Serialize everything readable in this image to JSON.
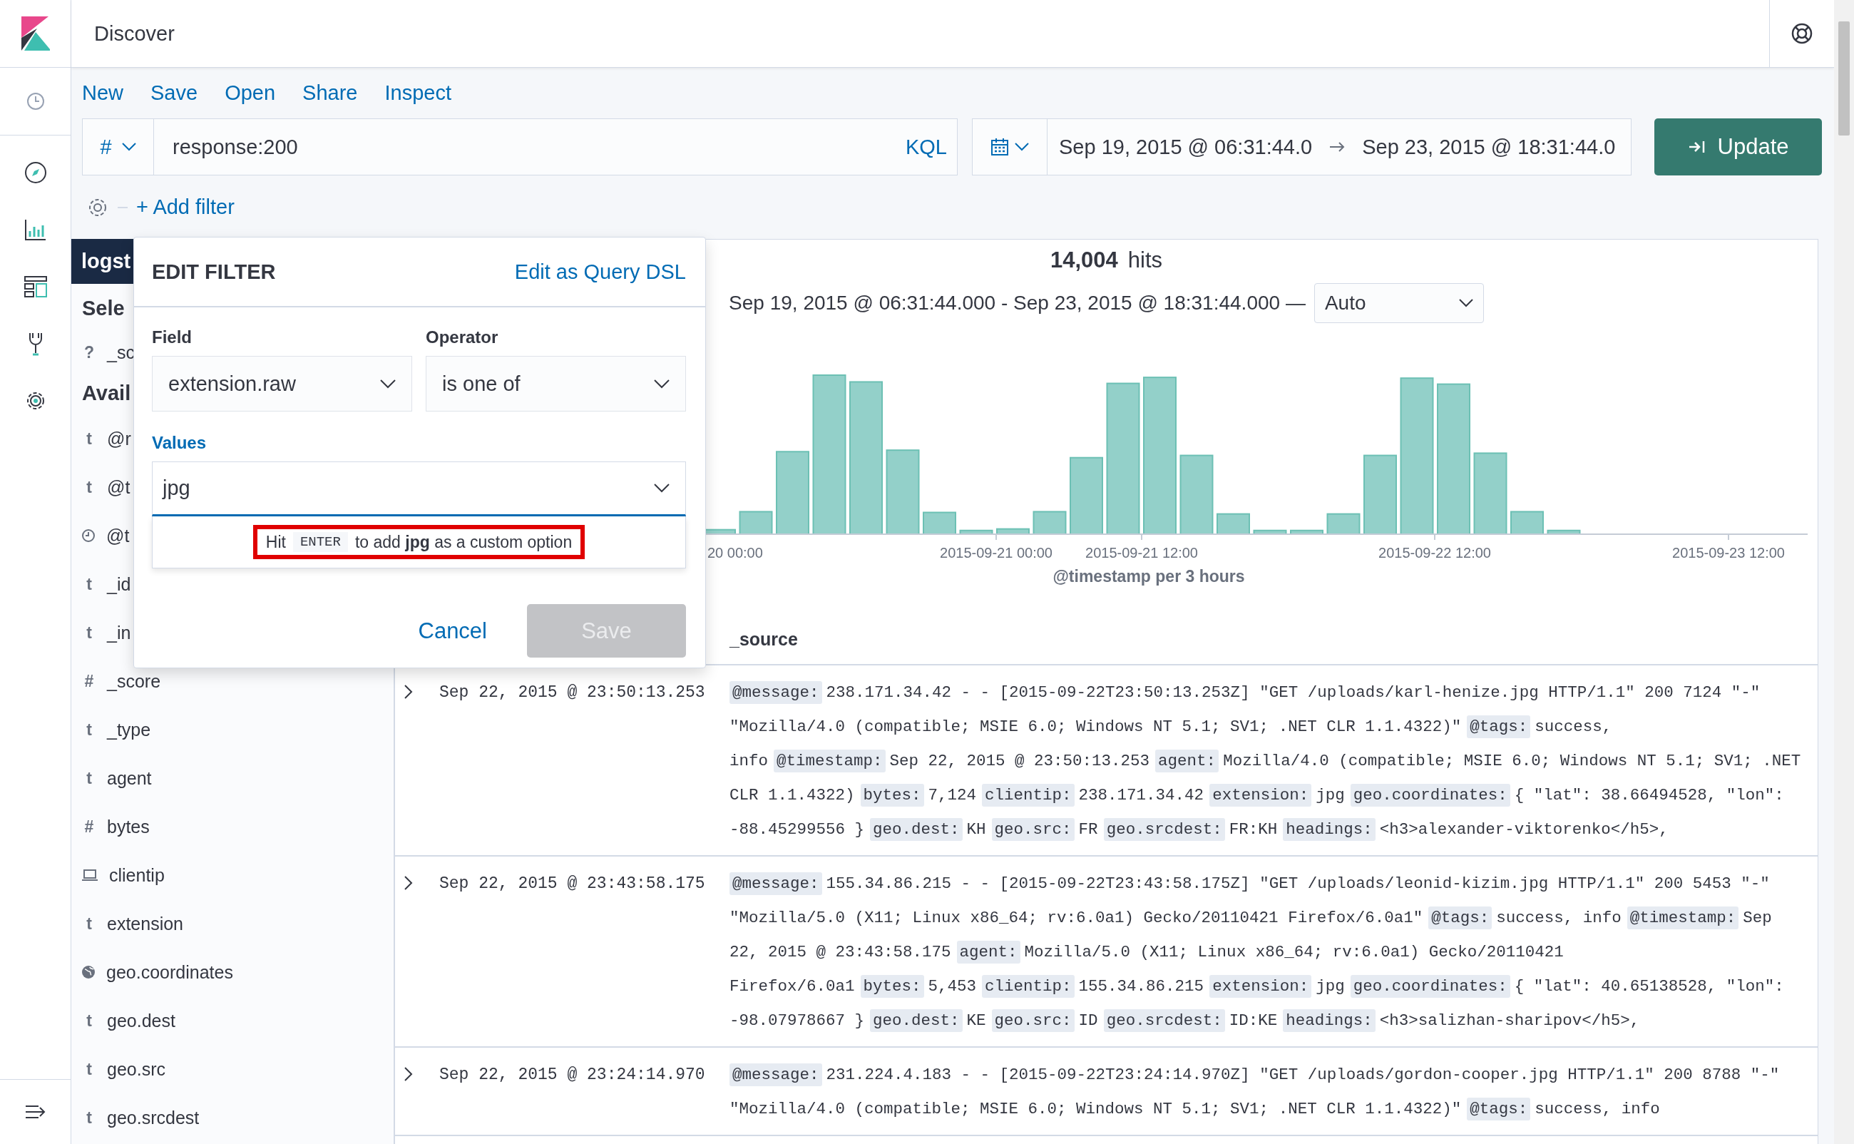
{
  "app": {
    "title": "Discover"
  },
  "menu": [
    "New",
    "Save",
    "Open",
    "Share",
    "Inspect"
  ],
  "query": {
    "language_symbol": "#",
    "value": "response:200",
    "language": "KQL"
  },
  "time_range": {
    "start": "Sep 19, 2015 @ 06:31:44.0",
    "end": "Sep 23, 2015 @ 18:31:44.0"
  },
  "update_button": "Update",
  "add_filter": "+ Add filter",
  "sidebar": {
    "index_pattern": "logst",
    "selected_heading": "Sele",
    "selected_fields": [
      {
        "kind": "glyph",
        "glyph": "?",
        "name": "_sc"
      }
    ],
    "available_heading": "Avail",
    "available_fields": [
      {
        "kind": "glyph",
        "glyph": "t",
        "name": "@r"
      },
      {
        "kind": "glyph",
        "glyph": "t",
        "name": "@t"
      },
      {
        "kind": "date",
        "name": "@t"
      },
      {
        "kind": "glyph",
        "glyph": "t",
        "name": "_id"
      },
      {
        "kind": "glyph",
        "glyph": "t",
        "name": "_in"
      },
      {
        "kind": "glyph",
        "glyph": "#",
        "name": "_score"
      },
      {
        "kind": "glyph",
        "glyph": "t",
        "name": "_type"
      },
      {
        "kind": "glyph",
        "glyph": "t",
        "name": "agent"
      },
      {
        "kind": "glyph",
        "glyph": "#",
        "name": "bytes"
      },
      {
        "kind": "ip",
        "name": "clientip"
      },
      {
        "kind": "glyph",
        "glyph": "t",
        "name": "extension"
      },
      {
        "kind": "geo",
        "name": "geo.coordinates"
      },
      {
        "kind": "glyph",
        "glyph": "t",
        "name": "geo.dest"
      },
      {
        "kind": "glyph",
        "glyph": "t",
        "name": "geo.src"
      },
      {
        "kind": "glyph",
        "glyph": "t",
        "name": "geo.srcdest"
      }
    ]
  },
  "results": {
    "hits_count": "14,004",
    "hits_label": "hits",
    "range": "Sep 19, 2015 @ 06:31:44.000 - Sep 23, 2015 @ 18:31:44.000 —",
    "interval": "Auto",
    "x_ticks": [
      "20 00:00",
      "2015-09-21 00:00",
      "2015-09-21 12:00",
      "2015-09-22 12:00",
      "2015-09-23 12:00"
    ],
    "x_axis_title": "@timestamp per 3 hours",
    "column": "_source",
    "documents": [
      {
        "time": "Sep 22, 2015 @ 23:50:13.253",
        "fields": [
          {
            "key": "@message:",
            "value": "238.171.34.42 - - [2015-09-22T23:50:13.253Z] \"GET /uploads/karl-henize.jpg HTTP/1.1\" 200 7124 \"-\" \"Mozilla/4.0 (compatible; MSIE 6.0; Windows NT 5.1; SV1; .NET CLR 1.1.4322)\""
          },
          {
            "key": "@tags:",
            "value": "success, info"
          },
          {
            "key": "@timestamp:",
            "value": "Sep 22, 2015 @ 23:50:13.253"
          },
          {
            "key": "agent:",
            "value": "Mozilla/4.0 (compatible; MSIE 6.0; Windows NT 5.1; SV1; .NET CLR 1.1.4322)"
          },
          {
            "key": "bytes:",
            "value": "7,124"
          },
          {
            "key": "clientip:",
            "value": "238.171.34.42"
          },
          {
            "key": "extension:",
            "value": "jpg"
          },
          {
            "key": "geo.coordinates:",
            "value": "{ \"lat\": 38.66494528, \"lon\": -88.45299556 }"
          },
          {
            "key": "geo.dest:",
            "value": "KH"
          },
          {
            "key": "geo.src:",
            "value": "FR"
          },
          {
            "key": "geo.srcdest:",
            "value": "FR:KH"
          },
          {
            "key": "headings:",
            "value": "<h3>alexander-viktorenko</h5>,"
          }
        ]
      },
      {
        "time": "Sep 22, 2015 @ 23:43:58.175",
        "fields": [
          {
            "key": "@message:",
            "value": "155.34.86.215 - - [2015-09-22T23:43:58.175Z] \"GET /uploads/leonid-kizim.jpg HTTP/1.1\" 200 5453 \"-\" \"Mozilla/5.0 (X11; Linux x86_64; rv:6.0a1) Gecko/20110421 Firefox/6.0a1\""
          },
          {
            "key": "@tags:",
            "value": "success, info"
          },
          {
            "key": "@timestamp:",
            "value": "Sep 22, 2015 @ 23:43:58.175"
          },
          {
            "key": "agent:",
            "value": "Mozilla/5.0 (X11; Linux x86_64; rv:6.0a1) Gecko/20110421 Firefox/6.0a1"
          },
          {
            "key": "bytes:",
            "value": "5,453"
          },
          {
            "key": "clientip:",
            "value": "155.34.86.215"
          },
          {
            "key": "extension:",
            "value": "jpg"
          },
          {
            "key": "geo.coordinates:",
            "value": "{ \"lat\": 40.65138528, \"lon\": -98.07978667 }"
          },
          {
            "key": "geo.dest:",
            "value": "KE"
          },
          {
            "key": "geo.src:",
            "value": "ID"
          },
          {
            "key": "geo.srcdest:",
            "value": "ID:KE"
          },
          {
            "key": "headings:",
            "value": "<h3>salizhan-sharipov</h5>,"
          }
        ]
      },
      {
        "time": "Sep 22, 2015 @ 23:24:14.970",
        "fields": [
          {
            "key": "@message:",
            "value": "231.224.4.183 - - [2015-09-22T23:24:14.970Z] \"GET /uploads/gordon-cooper.jpg HTTP/1.1\" 200 8788 \"-\" \"Mozilla/4.0 (compatible; MSIE 6.0; Windows NT 5.1; SV1; .NET CLR 1.1.4322)\""
          },
          {
            "key": "@tags:",
            "value": "success, info"
          }
        ]
      }
    ]
  },
  "filter_popup": {
    "title": "EDIT FILTER",
    "dsl_link": "Edit as Query DSL",
    "field": {
      "label": "Field",
      "value": "extension.raw"
    },
    "operator": {
      "label": "Operator",
      "value": "is one of"
    },
    "values": {
      "label": "Values",
      "value": "jpg",
      "focused": true
    },
    "hint": {
      "before": "Hit",
      "key": "ENTER",
      "after": "to add **jpg** as a custom option",
      "highlighted": true
    },
    "cancel": "Cancel",
    "save": {
      "label": "Save",
      "disabled": true
    }
  }
}
